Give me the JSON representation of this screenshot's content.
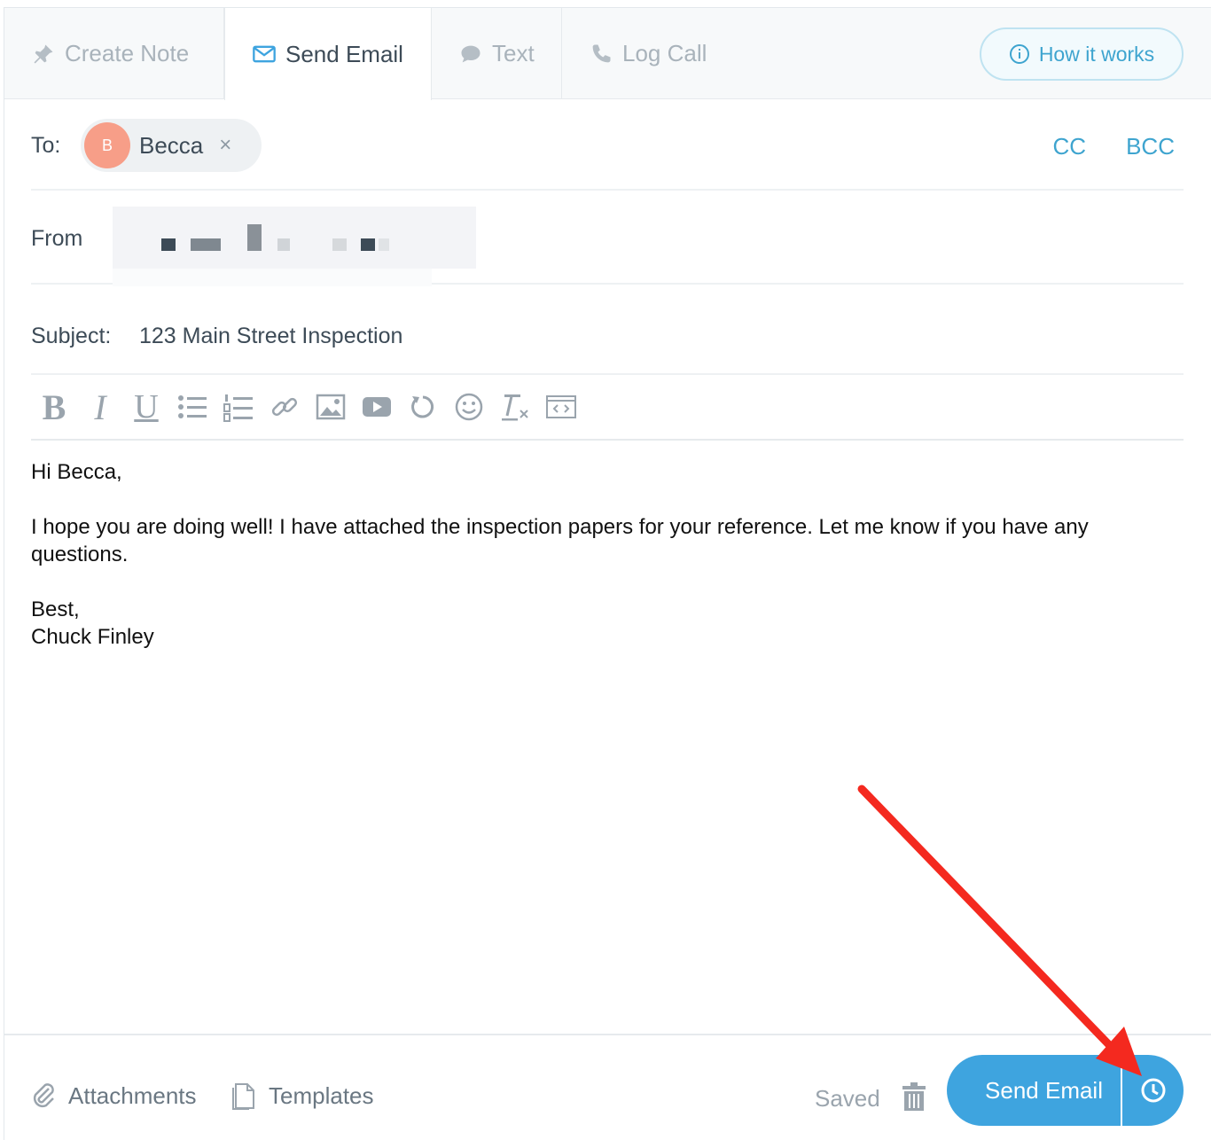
{
  "tabs": {
    "create_note": "Create Note",
    "send_email": "Send Email",
    "text": "Text",
    "log_call": "Log Call",
    "how_it_works": "How it works"
  },
  "compose": {
    "to_label": "To:",
    "recipient_initial": "B",
    "recipient_name": "Becca",
    "remove_symbol": "×",
    "cc": "CC",
    "bcc": "BCC",
    "from_label": "From",
    "subject_label": "Subject:",
    "subject_value": "123 Main Street Inspection"
  },
  "toolbar": {
    "bold": "B",
    "italic": "I",
    "underline": "U"
  },
  "body": {
    "greeting": "Hi Becca,",
    "paragraph": "I hope you are doing well! I have attached the inspection papers for your reference. Let me know if you have any questions.",
    "signoff": "Best,",
    "signature": "Chuck Finley"
  },
  "footer": {
    "attachments": "Attachments",
    "templates": "Templates",
    "saved": "Saved",
    "send_email": "Send Email"
  },
  "colors": {
    "accent": "#3ea4df",
    "avatar": "#f79e88",
    "annotation_arrow": "#f4291f"
  },
  "icons": [
    "pin-icon",
    "envelope-icon",
    "chat-bubble-icon",
    "phone-icon",
    "info-icon",
    "paperclip-icon",
    "document-icon",
    "trash-icon",
    "clock-icon"
  ]
}
